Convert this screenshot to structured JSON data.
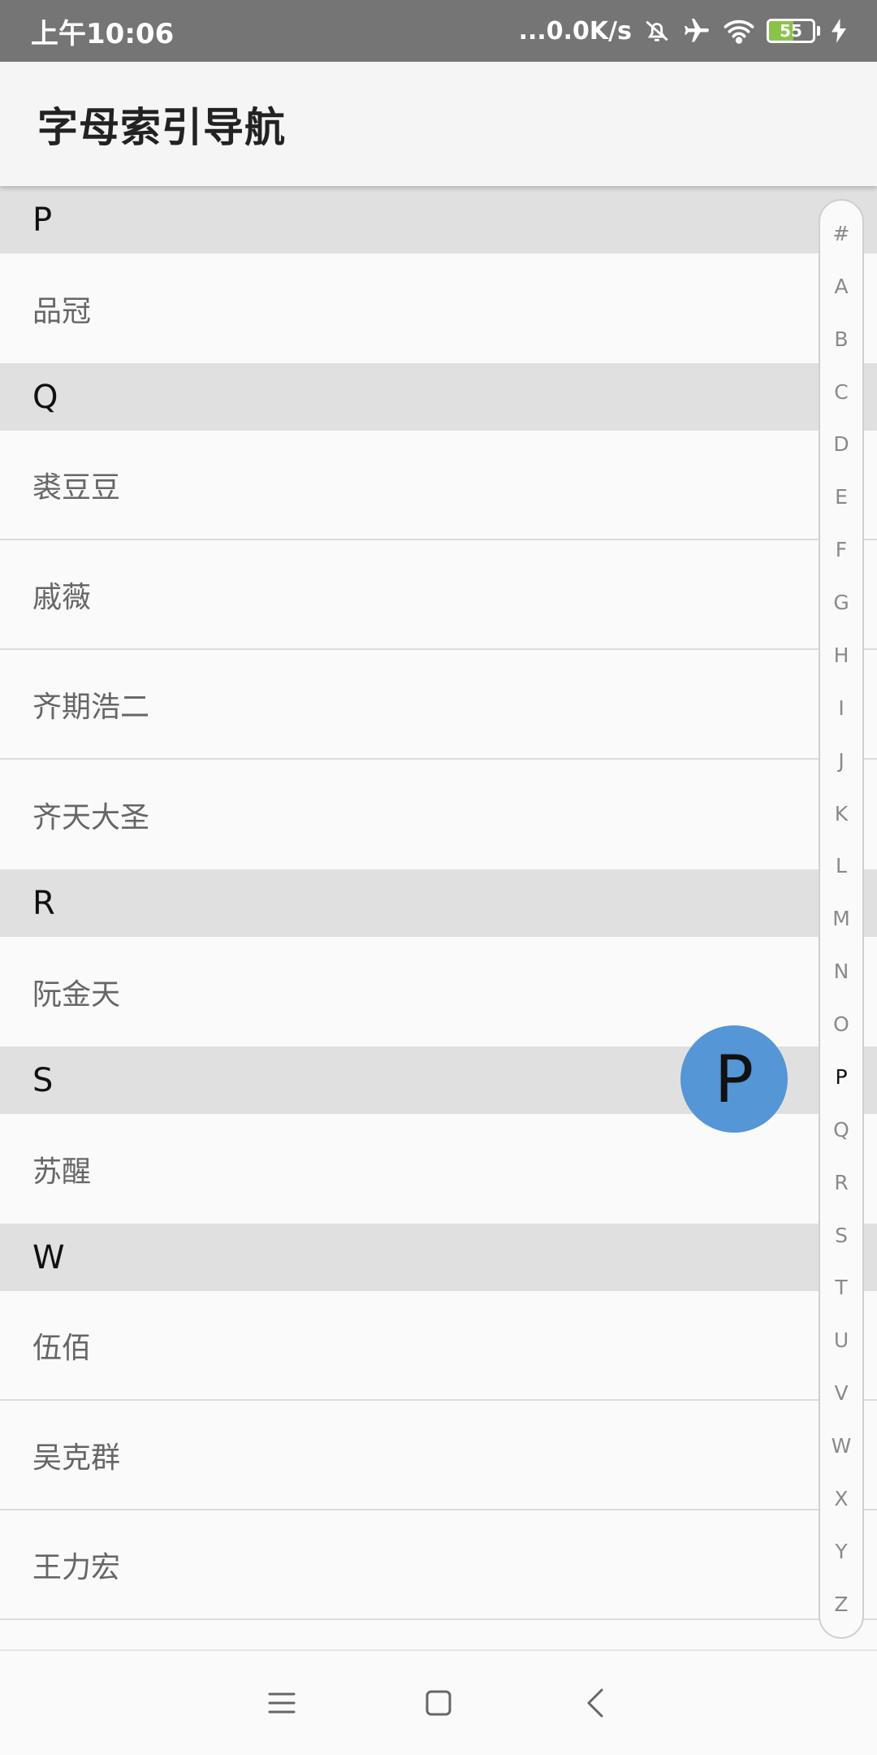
{
  "status_bar": {
    "time": "上午10:06",
    "network_speed": "...0.0K/s",
    "battery": "55",
    "battery_level": 0.55,
    "icons": [
      "mute-icon",
      "airplane-icon",
      "wifi-icon",
      "battery-icon",
      "charging-icon"
    ]
  },
  "app_bar": {
    "title": "字母索引导航"
  },
  "list": [
    {
      "header": "P",
      "items": [
        "品冠"
      ]
    },
    {
      "header": "Q",
      "items": [
        "裘豆豆",
        "戚薇",
        "齐期浩二",
        "齐天大圣"
      ]
    },
    {
      "header": "R",
      "items": [
        "阮金天"
      ]
    },
    {
      "header": "S",
      "items": [
        "苏醒"
      ]
    },
    {
      "header": "W",
      "items": [
        "伍佰",
        "吴克群",
        "王力宏"
      ]
    }
  ],
  "index_bar": {
    "letters": [
      "#",
      "A",
      "B",
      "C",
      "D",
      "E",
      "F",
      "G",
      "H",
      "I",
      "J",
      "K",
      "L",
      "M",
      "N",
      "O",
      "P",
      "Q",
      "R",
      "S",
      "T",
      "U",
      "V",
      "W",
      "X",
      "Y",
      "Z"
    ],
    "active": "P"
  },
  "bubble": {
    "letter": "P"
  },
  "colors": {
    "status_bar": "#757575",
    "bubble": "#5496d6",
    "section_header": "#e0e0e0",
    "battery_fill": "#8bc34a"
  },
  "nav_bar": {
    "icons": [
      "menu-icon",
      "home-icon",
      "back-icon"
    ]
  }
}
